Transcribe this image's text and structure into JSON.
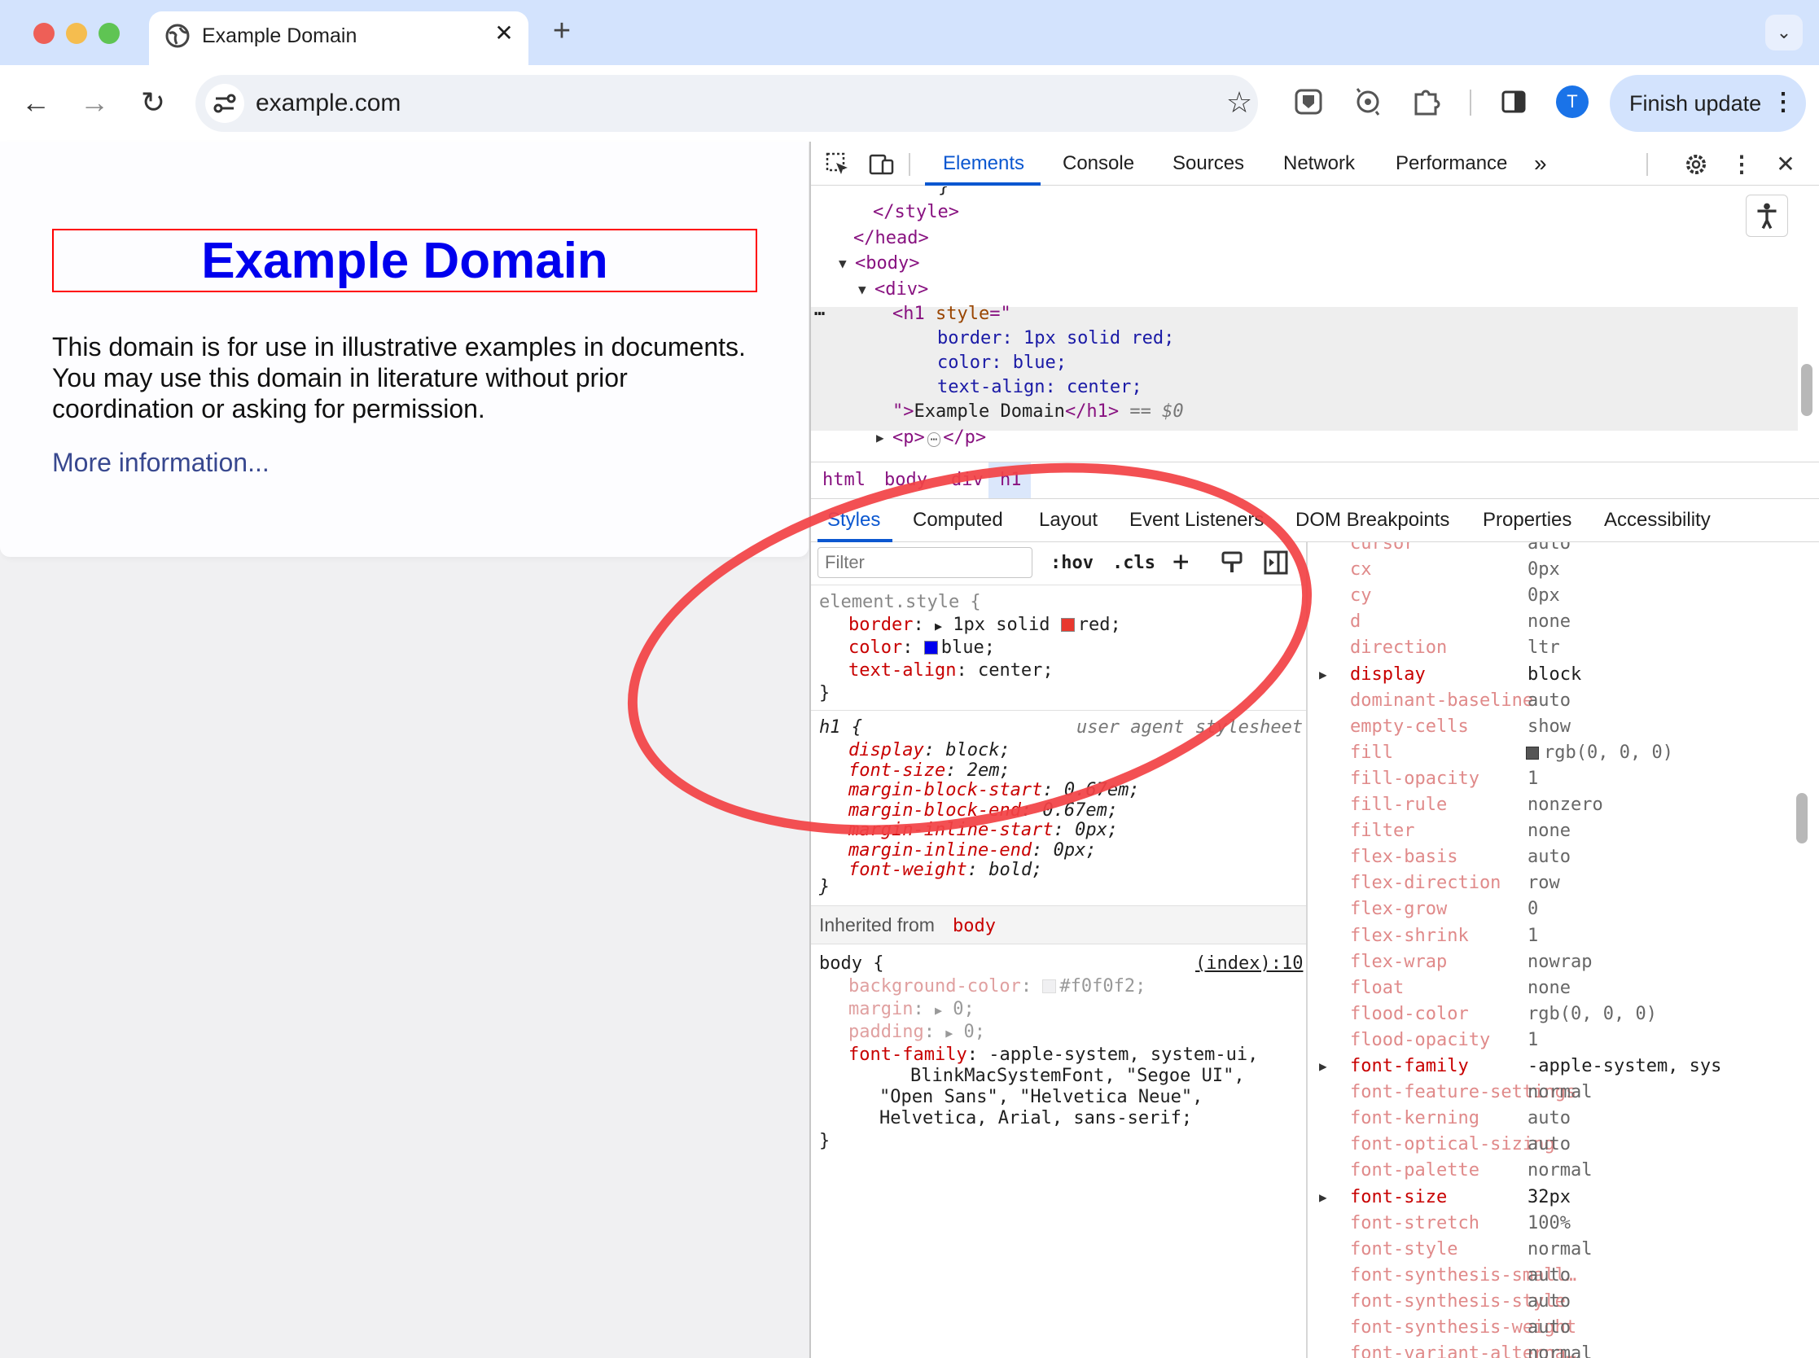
{
  "browser": {
    "tab": {
      "title": "Example Domain",
      "close": "✕"
    },
    "new_tab": "+",
    "tab_search": "⌄",
    "nav": {
      "back": "←",
      "forward": "→",
      "reload": "↻"
    },
    "url": "example.com",
    "star": "☆",
    "avatar_letter": "T",
    "finish_update": "Finish update",
    "menu": "⋮"
  },
  "page": {
    "heading": "Example Domain",
    "paragraph": "This domain is for use in illustrative examples in documents. You may use this domain in literature without prior coordination or asking for permission.",
    "link": "More information..."
  },
  "devtools": {
    "tabs": [
      "Elements",
      "Console",
      "Sources",
      "Network",
      "Performance"
    ],
    "more_tabs": "»",
    "dom": {
      "l0": "}",
      "l1": "</style>",
      "l2": "</head>",
      "l3": "<body>",
      "l4": "<div>",
      "l5_tag": "<h1",
      "l5_attr": " style",
      "l5_eq": "=\"",
      "l6": "border: 1px solid red;",
      "l7": "color: blue;",
      "l8": "text-align: center;",
      "l9_q": "\">",
      "l9_txt": "Example Domain",
      "l9_close": "</h1>",
      "l9_dollar": " == $0",
      "l10_open": "<p>",
      "l10_ell": "⋯",
      "l10_close": "</p>",
      "dots": "⋯"
    },
    "breadcrumbs": [
      "html",
      "body",
      "div",
      "h1"
    ],
    "subtabs": [
      "Styles",
      "Computed",
      "Layout",
      "Event Listeners",
      "DOM Breakpoints",
      "Properties",
      "Accessibility"
    ],
    "filter_placeholder": "Filter",
    "hov": ":hov",
    "cls": ".cls",
    "element_style": {
      "selector": "element.style {",
      "border_name": "border",
      "border_val1": "1px solid ",
      "border_val2": "red;",
      "color_name": "color",
      "color_val": "blue;",
      "align_name": "text-align",
      "align_val": "center;",
      "close": "}"
    },
    "ua_rule": {
      "selector": "h1 {",
      "source": "user agent stylesheet",
      "props": [
        {
          "n": "display",
          "v": "block;"
        },
        {
          "n": "font-size",
          "v": "2em;"
        },
        {
          "n": "margin-block-start",
          "v": "0.67em;"
        },
        {
          "n": "margin-block-end",
          "v": "0.67em;"
        },
        {
          "n": "margin-inline-start",
          "v": "0px;"
        },
        {
          "n": "margin-inline-end",
          "v": "0px;"
        },
        {
          "n": "font-weight",
          "v": "bold;"
        }
      ],
      "close": "}"
    },
    "inherited": {
      "label": "Inherited from ",
      "from": "body"
    },
    "body_rule": {
      "selector": "body {",
      "source": "(index):10",
      "bg_name": "background-color",
      "bg_val": "#f0f0f2;",
      "margin_name": "margin",
      "margin_val": "0;",
      "padding_name": "padding",
      "padding_val": "0;",
      "ff_name": "font-family",
      "ff_val1": "-apple-system, system-ui,",
      "ff_val2": "BlinkMacSystemFont, \"Segoe UI\",",
      "ff_val3": "\"Open Sans\", \"Helvetica Neue\",",
      "ff_val4": "Helvetica, Arial, sans-serif;",
      "close": "}"
    },
    "computed": [
      {
        "n": "cursor",
        "v": "auto",
        "arrow": false
      },
      {
        "n": "cx",
        "v": "0px",
        "arrow": false
      },
      {
        "n": "cy",
        "v": "0px",
        "arrow": false
      },
      {
        "n": "d",
        "v": "none",
        "arrow": false
      },
      {
        "n": "direction",
        "v": "ltr",
        "arrow": false
      },
      {
        "n": "display",
        "v": "block",
        "arrow": true
      },
      {
        "n": "dominant-baseline",
        "v": "auto",
        "arrow": false
      },
      {
        "n": "empty-cells",
        "v": "show",
        "arrow": false
      },
      {
        "n": "fill",
        "v": "rgb(0, 0, 0)",
        "arrow": false
      },
      {
        "n": "fill-opacity",
        "v": "1",
        "arrow": false
      },
      {
        "n": "fill-rule",
        "v": "nonzero",
        "arrow": false
      },
      {
        "n": "filter",
        "v": "none",
        "arrow": false
      },
      {
        "n": "flex-basis",
        "v": "auto",
        "arrow": false
      },
      {
        "n": "flex-direction",
        "v": "row",
        "arrow": false
      },
      {
        "n": "flex-grow",
        "v": "0",
        "arrow": false
      },
      {
        "n": "flex-shrink",
        "v": "1",
        "arrow": false
      },
      {
        "n": "flex-wrap",
        "v": "nowrap",
        "arrow": false
      },
      {
        "n": "float",
        "v": "none",
        "arrow": false
      },
      {
        "n": "flood-color",
        "v": "rgb(0, 0, 0)",
        "arrow": false
      },
      {
        "n": "flood-opacity",
        "v": "1",
        "arrow": false
      },
      {
        "n": "font-family",
        "v": "-apple-system, sys",
        "arrow": true
      },
      {
        "n": "font-feature-settings",
        "v": "normal",
        "arrow": false
      },
      {
        "n": "font-kerning",
        "v": "auto",
        "arrow": false
      },
      {
        "n": "font-optical-sizing",
        "v": "auto",
        "arrow": false
      },
      {
        "n": "font-palette",
        "v": "normal",
        "arrow": false
      },
      {
        "n": "font-size",
        "v": "32px",
        "arrow": true
      },
      {
        "n": "font-stretch",
        "v": "100%",
        "arrow": false
      },
      {
        "n": "font-style",
        "v": "normal",
        "arrow": false
      },
      {
        "n": "font-synthesis-small…",
        "v": "auto",
        "arrow": false
      },
      {
        "n": "font-synthesis-style",
        "v": "auto",
        "arrow": false
      },
      {
        "n": "font-synthesis-weight",
        "v": "auto",
        "arrow": false
      },
      {
        "n": "font-variant-alterna…",
        "v": "normal",
        "arrow": false
      }
    ]
  },
  "colors": {
    "annotation": "#f24346",
    "accent": "#0b57d0",
    "h1_color": "#0000ee",
    "border_red": "#ff0000"
  }
}
